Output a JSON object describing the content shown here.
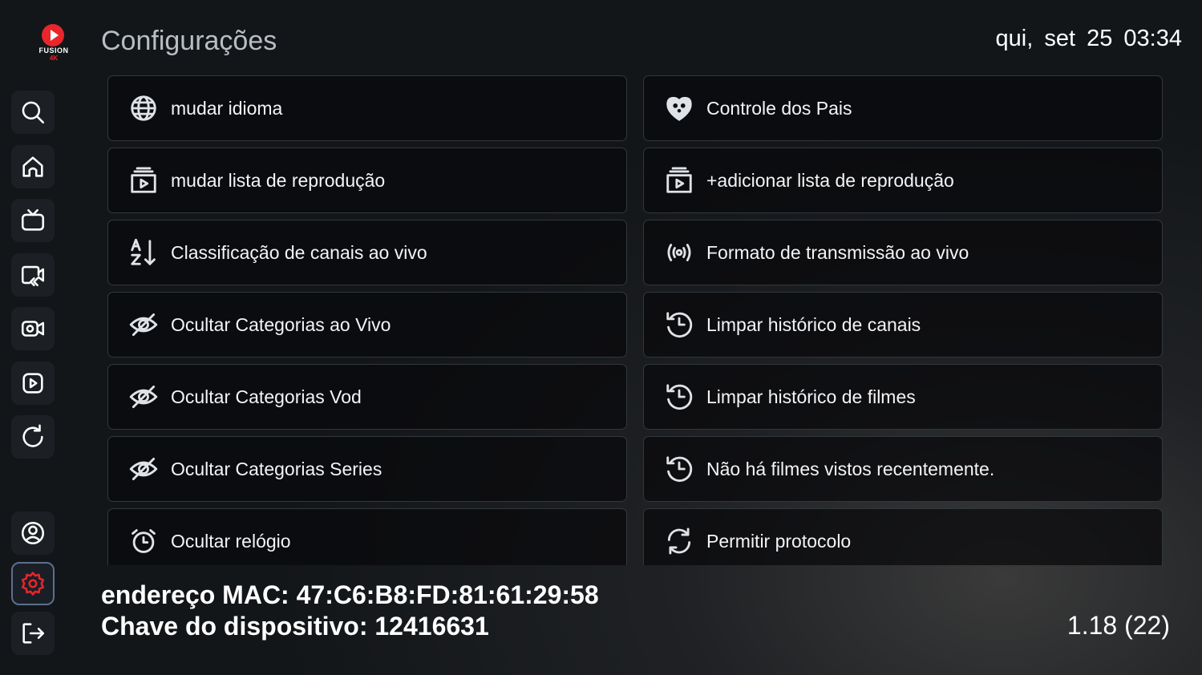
{
  "brand": {
    "name": "FUSION",
    "sub": "4K",
    "color": "#e8262b"
  },
  "header": {
    "title": "Configurações",
    "datetime": "qui, set 25  03:34"
  },
  "sidebar": {
    "items": [
      {
        "icon": "search-icon"
      },
      {
        "icon": "home-icon"
      },
      {
        "icon": "tv-icon"
      },
      {
        "icon": "catchup-icon"
      },
      {
        "icon": "movies-icon"
      },
      {
        "icon": "series-icon"
      },
      {
        "icon": "refresh-icon"
      },
      {
        "icon": "user-icon"
      },
      {
        "icon": "settings-icon",
        "active": true
      },
      {
        "icon": "logout-icon"
      }
    ]
  },
  "settings": {
    "left": [
      {
        "label": "mudar idioma",
        "icon": "globe-icon"
      },
      {
        "label": "mudar lista de reprodução",
        "icon": "playlist-icon"
      },
      {
        "label": "Classificação de canais ao vivo",
        "icon": "sort-az-icon"
      },
      {
        "label": "Ocultar Categorias ao Vivo",
        "icon": "eye-off-icon"
      },
      {
        "label": "Ocultar Categorias Vod",
        "icon": "eye-off-icon"
      },
      {
        "label": "Ocultar Categorias Series",
        "icon": "eye-off-icon"
      },
      {
        "label": "Ocultar relógio",
        "icon": "alarm-clock-icon"
      }
    ],
    "right": [
      {
        "label": "Controle dos Pais",
        "icon": "parental-icon"
      },
      {
        "label": "+adicionar lista de reprodução",
        "icon": "playlist-icon"
      },
      {
        "label": "Formato de transmissão ao vivo",
        "icon": "broadcast-icon"
      },
      {
        "label": "Limpar histórico de canais",
        "icon": "history-icon"
      },
      {
        "label": "Limpar histórico de filmes",
        "icon": "history-icon"
      },
      {
        "label": "Não há filmes vistos recentemente.",
        "icon": "history-icon"
      },
      {
        "label": "Permitir protocolo",
        "icon": "sync-icon"
      }
    ]
  },
  "footer": {
    "mac": "endereço MAC: 47:C6:B8:FD:81:61:29:58",
    "device_key": "Chave do dispositivo: 12416631",
    "version": "1.18 (22)"
  }
}
